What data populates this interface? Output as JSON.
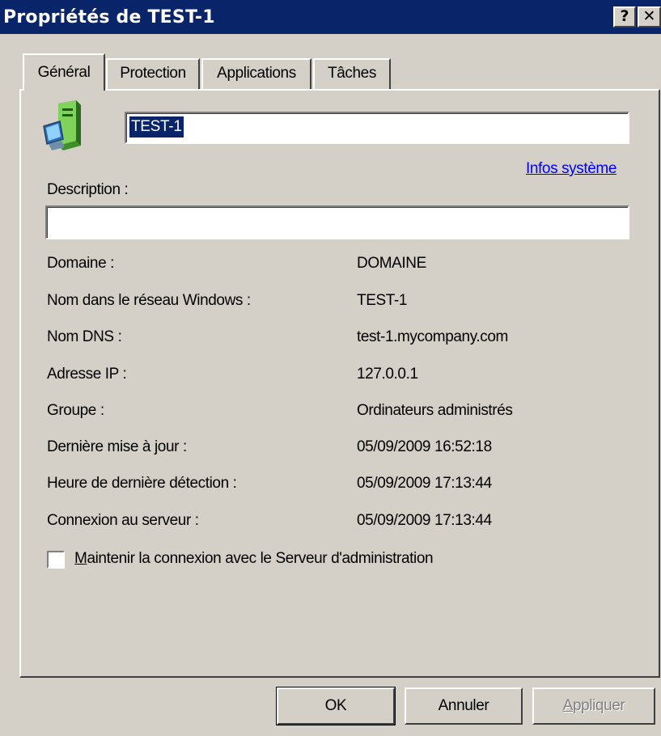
{
  "window": {
    "title": "Propriétés de TEST-1",
    "help_glyph": "?",
    "close_glyph": "✕"
  },
  "tabs": [
    {
      "label": "Général",
      "active": true
    },
    {
      "label": "Protection",
      "active": false
    },
    {
      "label": "Applications",
      "active": false
    },
    {
      "label": "Tâches",
      "active": false
    }
  ],
  "general": {
    "computer_name": "TEST-1",
    "system_info_link": "Infos système",
    "description_label": "Description :",
    "description_value": "",
    "properties": [
      {
        "label": "Domaine :",
        "value": "DOMAINE"
      },
      {
        "label": "Nom dans le réseau Windows :",
        "value": "TEST-1"
      },
      {
        "label": "Nom DNS :",
        "value": "test-1.mycompany.com"
      },
      {
        "label": "Adresse IP :",
        "value": "127.0.0.1"
      },
      {
        "label": "Groupe :",
        "value": "Ordinateurs administrés"
      },
      {
        "label": "Dernière mise à jour :",
        "value": "05/09/2009 16:52:18"
      },
      {
        "label": "Heure de dernière détection :",
        "value": "05/09/2009 17:13:44"
      },
      {
        "label": "Connexion au serveur :",
        "value": "05/09/2009 17:13:44"
      }
    ],
    "keep_connection": {
      "mnemonic": "M",
      "label_rest": "aintenir la connexion avec le Serveur d'administration",
      "checked": false
    }
  },
  "buttons": {
    "ok": "OK",
    "cancel": "Annuler",
    "apply_mnemonic": "A",
    "apply_rest": "ppliquer"
  }
}
